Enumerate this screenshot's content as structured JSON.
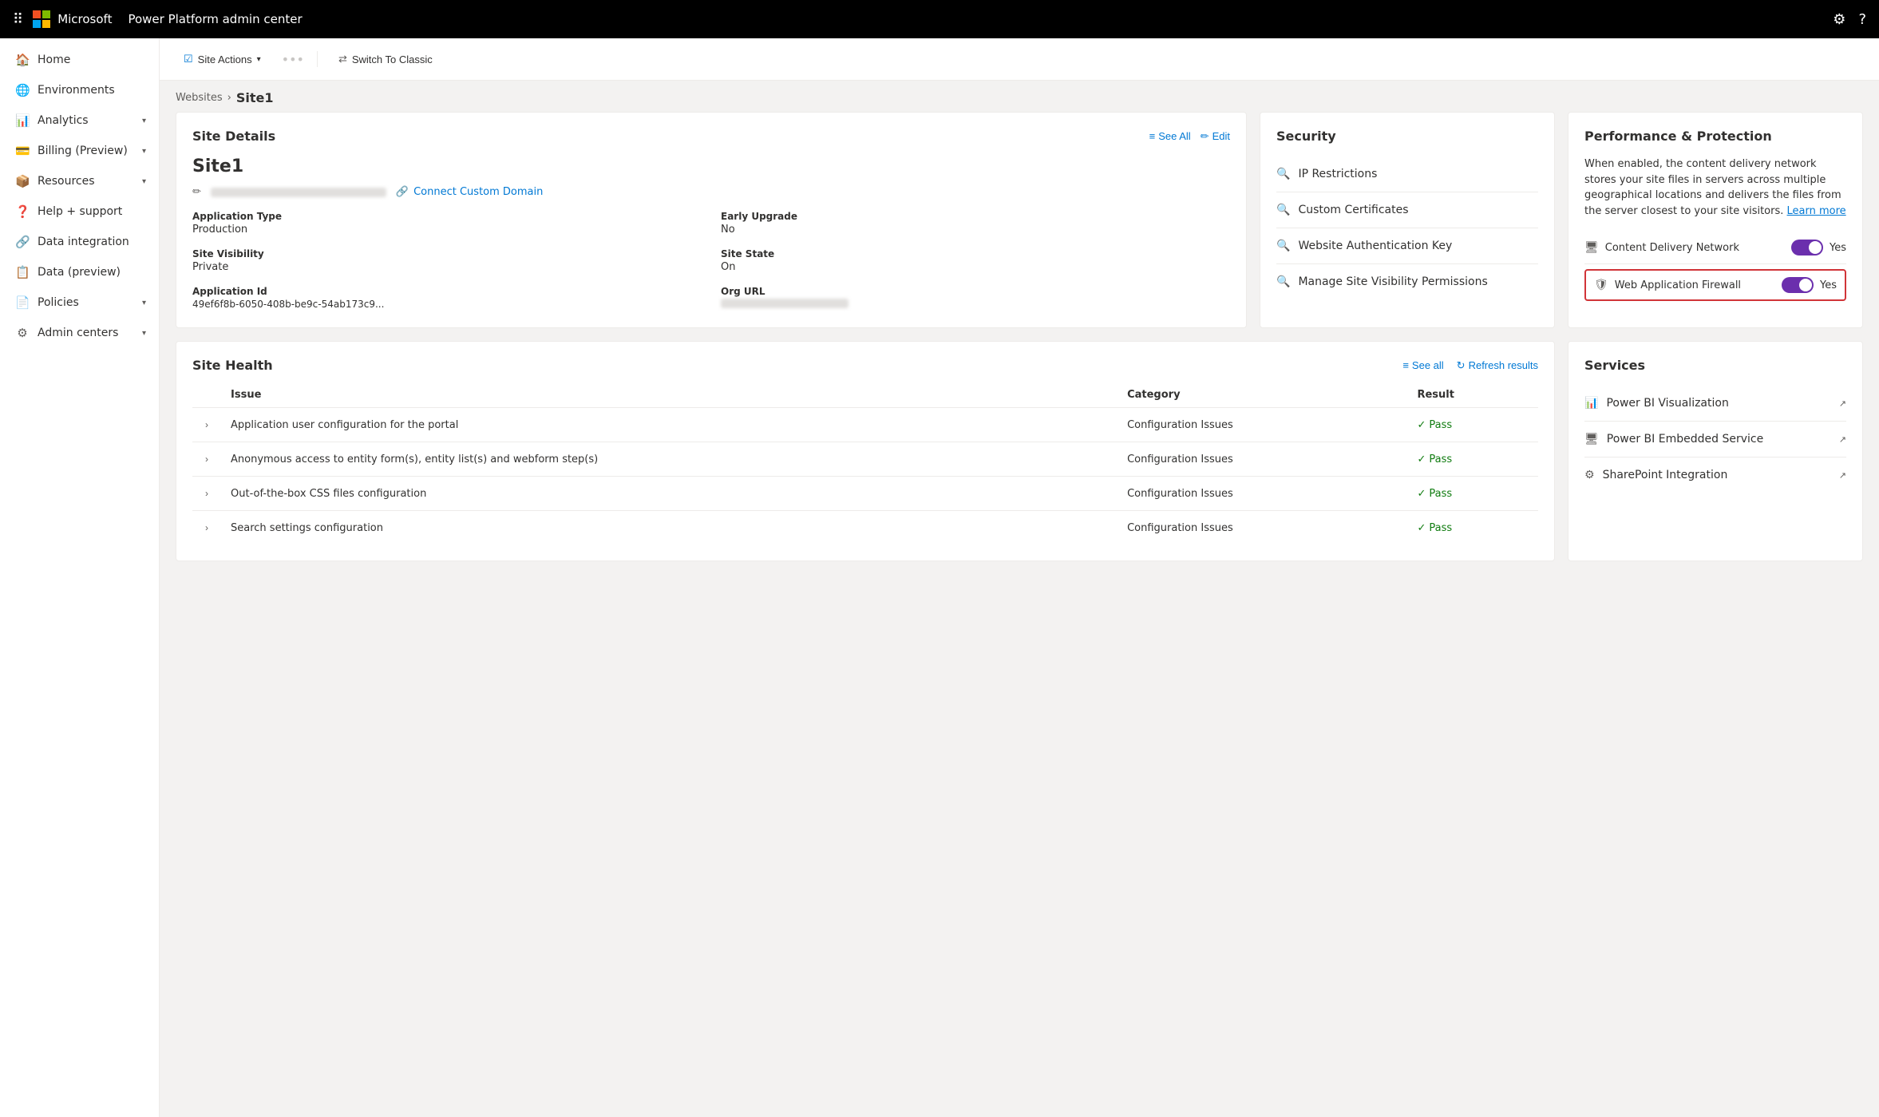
{
  "topnav": {
    "brand": "Power Platform admin center",
    "settings_icon": "⚙",
    "help_icon": "?"
  },
  "sidebar": {
    "menu_icon": "☰",
    "items": [
      {
        "id": "home",
        "label": "Home",
        "icon": "🏠",
        "hasChevron": false
      },
      {
        "id": "environments",
        "label": "Environments",
        "icon": "🌐",
        "hasChevron": false
      },
      {
        "id": "analytics",
        "label": "Analytics",
        "icon": "📊",
        "hasChevron": true
      },
      {
        "id": "billing",
        "label": "Billing (Preview)",
        "icon": "💳",
        "hasChevron": true
      },
      {
        "id": "resources",
        "label": "Resources",
        "icon": "📦",
        "hasChevron": true
      },
      {
        "id": "help",
        "label": "Help + support",
        "icon": "❓",
        "hasChevron": false
      },
      {
        "id": "data-integration",
        "label": "Data integration",
        "icon": "🔗",
        "hasChevron": false
      },
      {
        "id": "data-preview",
        "label": "Data (preview)",
        "icon": "📋",
        "hasChevron": false
      },
      {
        "id": "policies",
        "label": "Policies",
        "icon": "📄",
        "hasChevron": true
      },
      {
        "id": "admin-centers",
        "label": "Admin centers",
        "icon": "⚙",
        "hasChevron": true
      }
    ]
  },
  "toolbar": {
    "site_actions_label": "Site Actions",
    "switch_to_classic_label": "Switch To Classic"
  },
  "breadcrumb": {
    "parent": "Websites",
    "current": "Site1"
  },
  "site_details": {
    "title": "Site Details",
    "see_all_label": "See All",
    "edit_label": "Edit",
    "site_name": "Site1",
    "connect_domain_label": "Connect Custom Domain",
    "fields": [
      {
        "label": "Application Type",
        "value": "Production"
      },
      {
        "label": "Early Upgrade",
        "value": "No"
      },
      {
        "label": "Site Visibility",
        "value": "Private"
      },
      {
        "label": "Site State",
        "value": "On"
      },
      {
        "label": "Application Id",
        "value": "49ef6f8b-6050-408b-be9c-54ab173c9..."
      },
      {
        "label": "Org URL",
        "value": "blurred"
      }
    ]
  },
  "security": {
    "title": "Security",
    "items": [
      {
        "id": "ip-restrictions",
        "label": "IP Restrictions",
        "icon": "🔍"
      },
      {
        "id": "custom-certificates",
        "label": "Custom Certificates",
        "icon": "🔍"
      },
      {
        "id": "website-auth-key",
        "label": "Website Authentication Key",
        "icon": "🔍"
      },
      {
        "id": "site-visibility",
        "label": "Manage Site Visibility Permissions",
        "icon": "🔍"
      }
    ]
  },
  "performance": {
    "title": "Performance & Protection",
    "description": "When enabled, the content delivery network stores your site files in servers across multiple geographical locations and delivers the files from the server closest to your site visitors.",
    "learn_more_label": "Learn more",
    "toggles": [
      {
        "id": "cdn",
        "icon": "🖥",
        "label": "Content Delivery Network",
        "enabled": true,
        "value": "Yes",
        "highlighted": false
      },
      {
        "id": "waf",
        "icon": "🛡",
        "label": "Web Application Firewall",
        "enabled": true,
        "value": "Yes",
        "highlighted": true
      }
    ]
  },
  "site_health": {
    "title": "Site Health",
    "see_all_label": "See all",
    "refresh_label": "Refresh results",
    "columns": [
      "Issue",
      "Category",
      "Result"
    ],
    "rows": [
      {
        "issue": "Application user configuration for the portal",
        "category": "Configuration Issues",
        "result": "Pass"
      },
      {
        "issue": "Anonymous access to entity form(s), entity list(s) and webform step(s)",
        "category": "Configuration Issues",
        "result": "Pass"
      },
      {
        "issue": "Out-of-the-box CSS files configuration",
        "category": "Configuration Issues",
        "result": "Pass"
      },
      {
        "issue": "Search settings configuration",
        "category": "Configuration Issues",
        "result": "Pass"
      }
    ]
  },
  "services": {
    "title": "Services",
    "items": [
      {
        "id": "power-bi-viz",
        "label": "Power BI Visualization",
        "icon": "📊"
      },
      {
        "id": "power-bi-embedded",
        "label": "Power BI Embedded Service",
        "icon": "🖥"
      },
      {
        "id": "sharepoint",
        "label": "SharePoint Integration",
        "icon": "⚙"
      }
    ]
  }
}
